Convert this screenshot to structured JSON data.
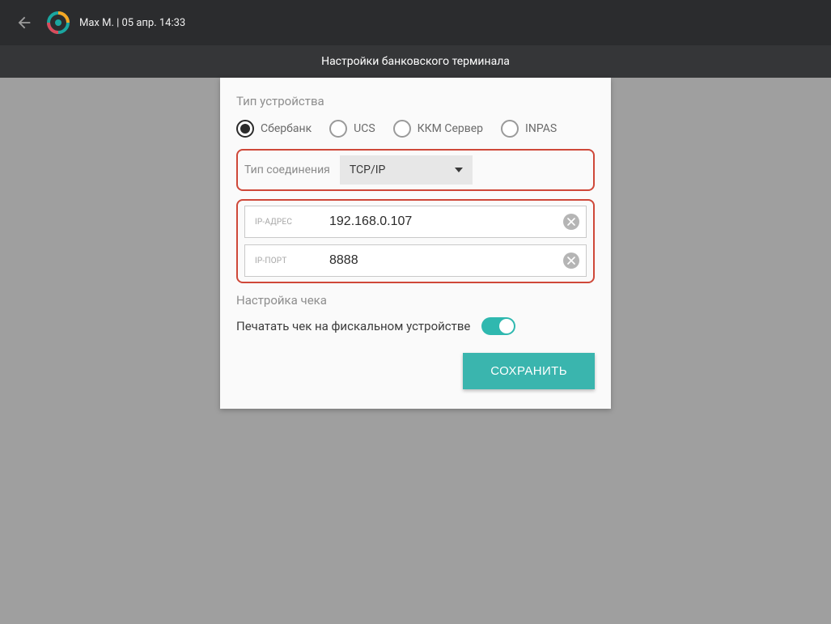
{
  "topbar": {
    "user": "Max M.",
    "separator": " | ",
    "datetime": "05 апр. 14:33"
  },
  "titlebar": {
    "title": "Настройки банковского терминала"
  },
  "device": {
    "section_label": "Тип устройства",
    "options": {
      "sberbank": "Сбербанк",
      "ucs": "UCS",
      "kkm": "ККМ Сервер",
      "inpas": "INPAS"
    },
    "selected": "sberbank"
  },
  "connection": {
    "label": "Тип соединения",
    "value": "TCP/IP"
  },
  "fields": {
    "ip_address": {
      "label": "IP-АДРЕС",
      "value": "192.168.0.107"
    },
    "ip_port": {
      "label": "IP-ПОРТ",
      "value": "8888"
    }
  },
  "receipt": {
    "section_label": "Настройка чека",
    "toggle_label": "Печатать чек на фискальном устройстве",
    "enabled": true
  },
  "actions": {
    "save_label": "СОХРАНИТЬ"
  },
  "colors": {
    "accent": "#3ab5ae",
    "callout_border": "#cf4839"
  }
}
